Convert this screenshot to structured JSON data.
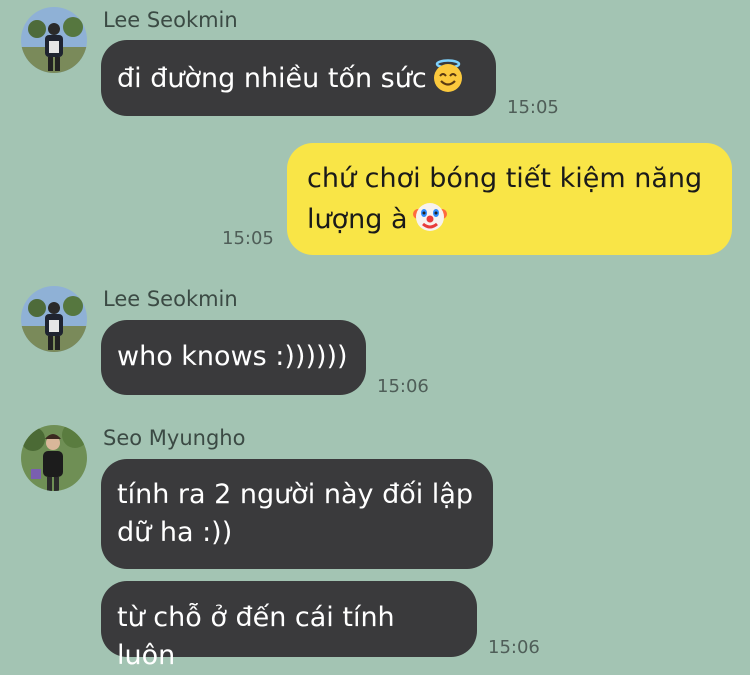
{
  "messages": [
    {
      "sender": "Lee Seokmin",
      "text": "đi đường nhiều tốn sức",
      "emoji": "smiling-face-with-halo",
      "time": "15:05"
    },
    {
      "sender": "me",
      "text": "chứ chơi bóng tiết kiệm năng lượng à",
      "emoji": "clown-face",
      "time": "15:05"
    },
    {
      "sender": "Lee Seokmin",
      "text": "who knows :))))))",
      "time": "15:06"
    },
    {
      "sender": "Seo Myungho",
      "text": "tính ra 2 người này đối lập dữ ha :))"
    },
    {
      "sender": "Seo Myungho",
      "text": "từ chỗ ở đến cái tính luôn",
      "time": "15:06"
    }
  ],
  "colors": {
    "background": "#a3c4b3",
    "incoming_bubble": "#3a3a3c",
    "outgoing_bubble": "#f9e547"
  }
}
